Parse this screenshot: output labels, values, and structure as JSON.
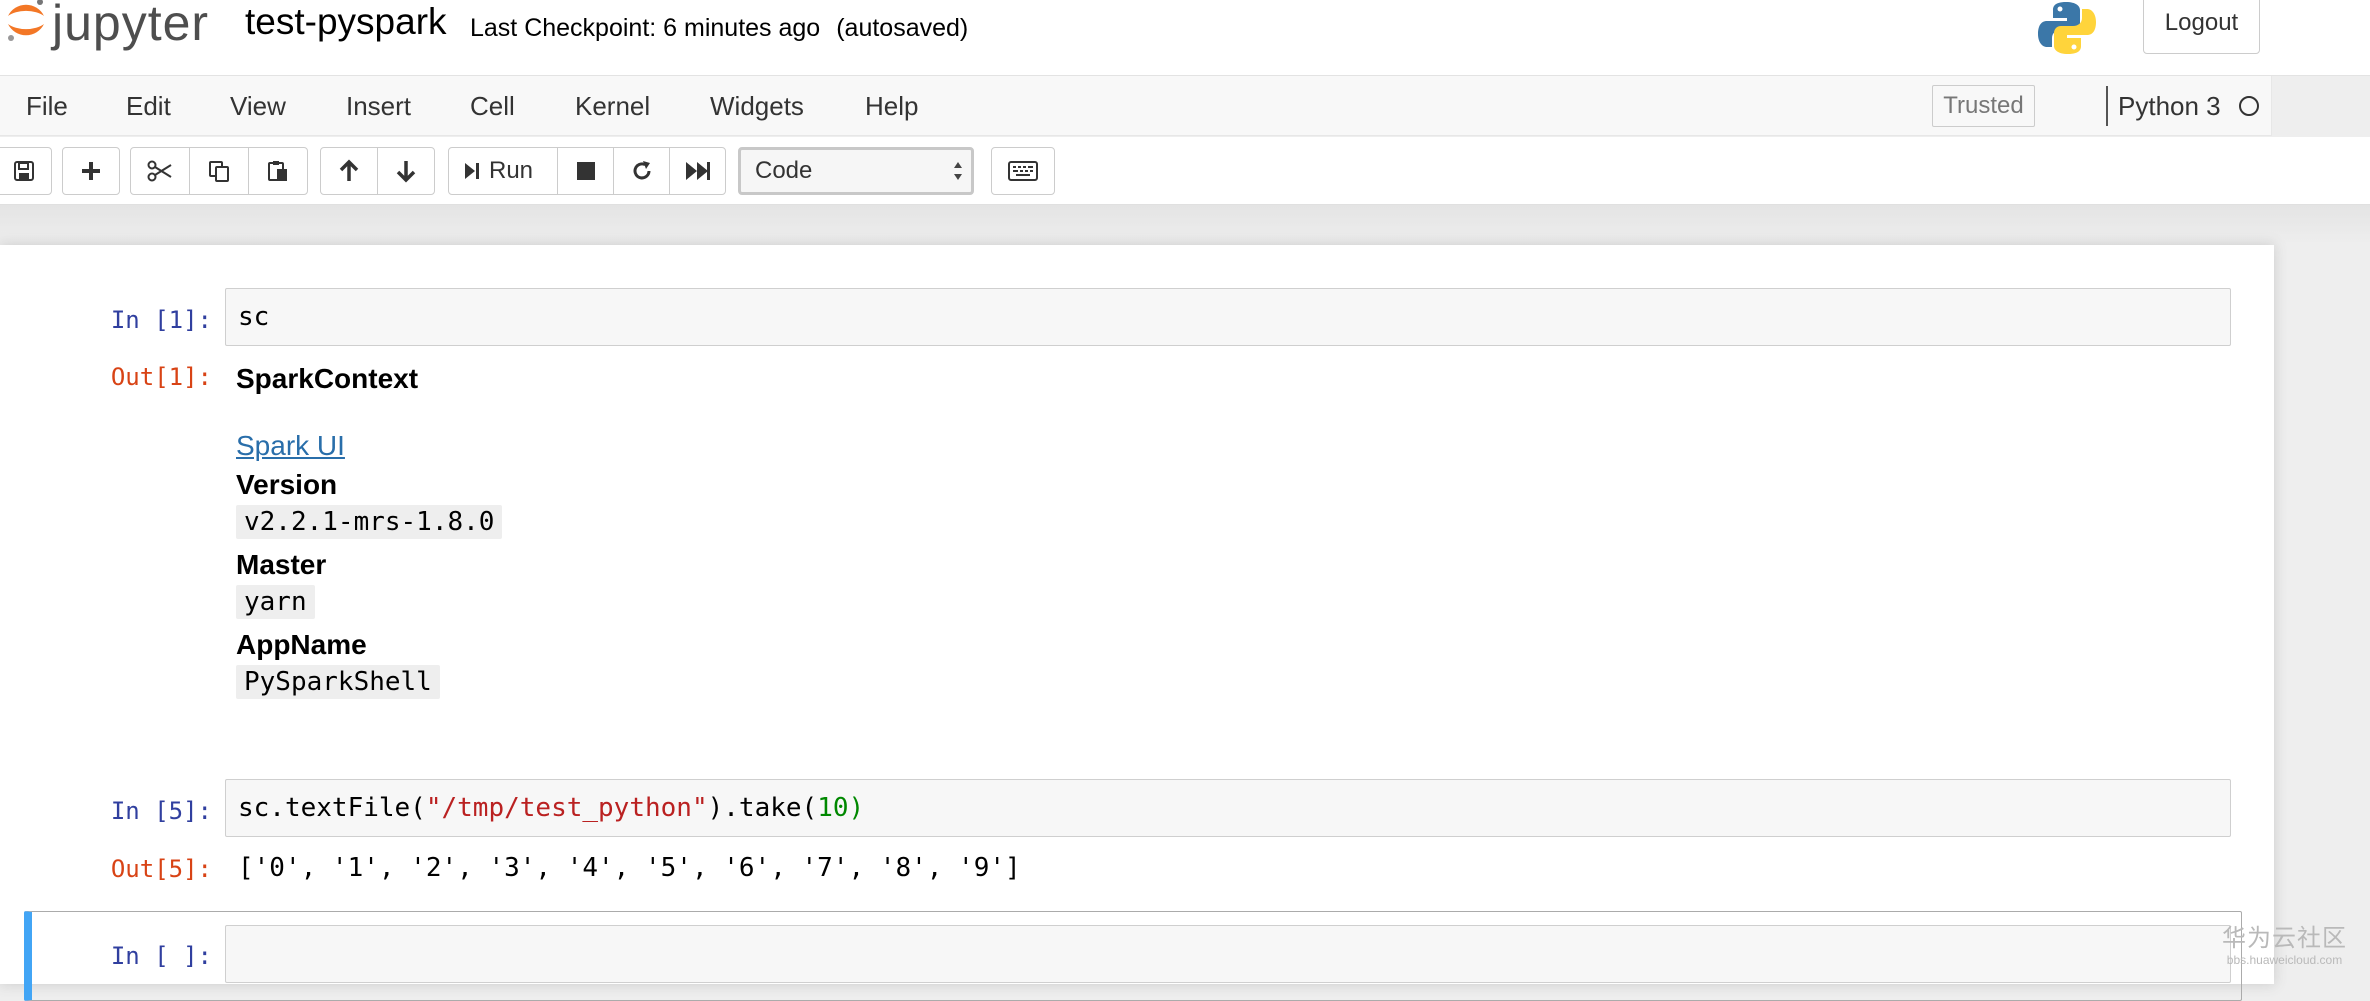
{
  "header": {
    "logo_text": "jupyter",
    "notebook_name": "test-pyspark",
    "checkpoint_text": "Last Checkpoint: 6 minutes ago",
    "autosave_status": "(autosaved)",
    "logout_label": "Logout"
  },
  "menubar": {
    "items": [
      "File",
      "Edit",
      "View",
      "Insert",
      "Cell",
      "Kernel",
      "Widgets",
      "Help"
    ],
    "trusted_label": "Trusted",
    "kernel_name": "Python 3"
  },
  "toolbar": {
    "run_label": "Run",
    "cell_type": "Code"
  },
  "cells": [
    {
      "in_prompt": "In [1]:",
      "code": "sc",
      "out_prompt": "Out[1]:",
      "output": {
        "title": "SparkContext",
        "link_label": "Spark UI",
        "version_label": "Version",
        "version_value": "v2.2.1-mrs-1.8.0",
        "master_label": "Master",
        "master_value": "yarn",
        "appname_label": "AppName",
        "appname_value": "PySparkShell"
      }
    },
    {
      "in_prompt": "In [5]:",
      "code_prefix": "sc.textFile(",
      "code_string": "\"/tmp/test_python\"",
      "code_middle": ").take(",
      "code_number": "10",
      "code_suffix": ")",
      "out_prompt": "Out[5]:",
      "output_text": "['0', '1', '2', '3', '4', '5', '6', '7', '8', '9']"
    },
    {
      "in_prompt": "In [ ]:",
      "code": ""
    }
  ],
  "watermark": {
    "main": "华为云社区",
    "sub": "bbs.huaweicloud.com"
  },
  "colors": {
    "prompt_in": "#303f9f",
    "prompt_out": "#d84315",
    "string": "#ba2121",
    "number": "#008800",
    "selected_cell_bar": "#42a5f5",
    "link": "#296eaa"
  }
}
